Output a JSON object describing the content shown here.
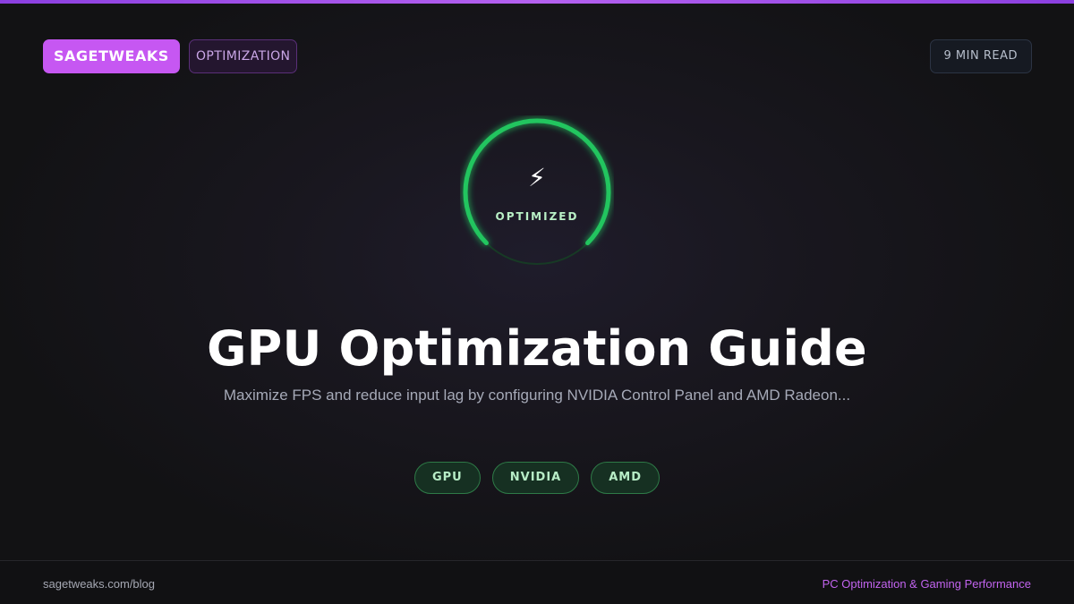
{
  "header": {
    "brand": "SAGETWEAKS",
    "category": "OPTIMIZATION",
    "read_time": "9 MIN READ"
  },
  "gauge": {
    "icon": "lightning-bolt-icon",
    "glyph": "⚡",
    "label": "OPTIMIZED",
    "color": "#22c55e",
    "fill_fraction": 0.75
  },
  "hero": {
    "title": "GPU Optimization Guide",
    "subtitle": "Maximize FPS and reduce input lag by configuring NVIDIA Control Panel and AMD Radeon..."
  },
  "tags": [
    "GPU",
    "NVIDIA",
    "AMD"
  ],
  "footer": {
    "url": "sagetweaks.com/blog",
    "tagline": "PC Optimization & Gaming Performance"
  },
  "colors": {
    "accent": "#c657f2",
    "success": "#22c55e",
    "background": "#19171f"
  }
}
